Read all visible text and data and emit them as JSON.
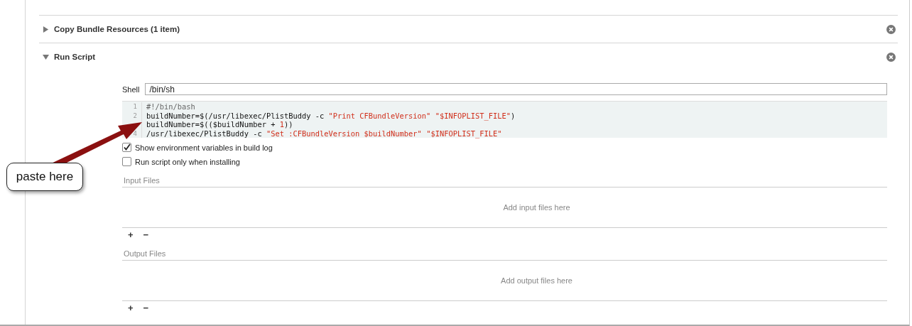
{
  "phases": [
    {
      "title": "Copy Bundle Resources (1 item)",
      "expanded": false
    },
    {
      "title": "Run Script",
      "expanded": true
    }
  ],
  "run_script": {
    "shell_label": "Shell",
    "shell_value": "/bin/sh",
    "lines": [
      {
        "number": "1",
        "tokens": [
          {
            "kind": "comment",
            "text": "#!/bin/bash"
          }
        ]
      },
      {
        "number": "2",
        "tokens": [
          {
            "kind": "plain",
            "text": "buildNumber=$(/usr/libexec/PlistBuddy -c "
          },
          {
            "kind": "string",
            "text": "\"Print CFBundleVersion\" "
          },
          {
            "kind": "string",
            "text": "\"$INFOPLIST_FILE\""
          },
          {
            "kind": "plain",
            "text": ")"
          }
        ]
      },
      {
        "tokens": [
          {
            "kind": "plain",
            "text": "buildNumber=$(($buildNumber + "
          },
          {
            "kind": "number",
            "text": "1"
          },
          {
            "kind": "plain",
            "text": "))"
          }
        ]
      },
      {
        "number": "4",
        "tokens": [
          {
            "kind": "plain",
            "text": "/usr/libexec/PlistBuddy -c "
          },
          {
            "kind": "string",
            "text": "\"Set :CFBundleVersion $buildNumber\" "
          },
          {
            "kind": "string",
            "text": "\"$INFOPLIST_FILE\""
          }
        ]
      }
    ],
    "options": [
      {
        "label": "Show environment variables in build log",
        "checked": true
      },
      {
        "label": "Run script only when installing",
        "checked": false
      }
    ],
    "file_lists": [
      {
        "title": "Input Files",
        "placeholder": "Add input files here",
        "add": "+",
        "remove": "−"
      },
      {
        "title": "Output Files",
        "placeholder": "Add output files here",
        "add": "+",
        "remove": "−"
      }
    ]
  },
  "callout": {
    "text": "paste here"
  }
}
